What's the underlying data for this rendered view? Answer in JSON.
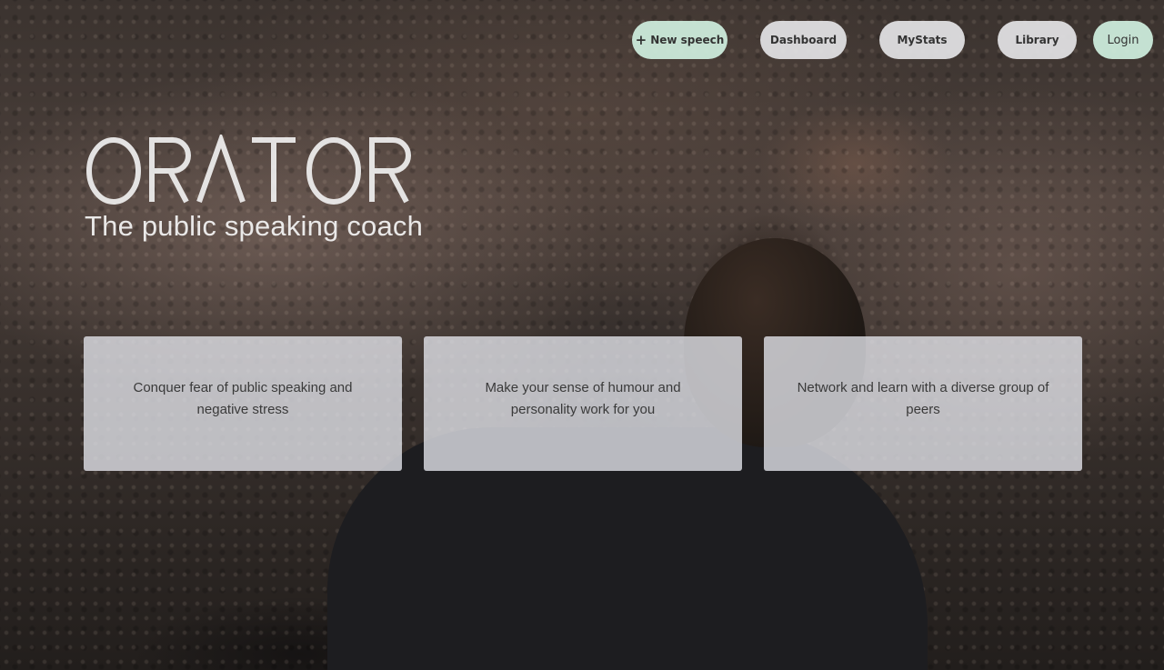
{
  "nav": {
    "new_speech": "New speech",
    "dashboard": "Dashboard",
    "mystats": "MyStats",
    "library": "Library",
    "login": "Login",
    "new_speech_icon": "plus-icon"
  },
  "hero": {
    "logo_text": "ORATOR",
    "tagline": "The public speaking coach"
  },
  "cards": [
    {
      "text": "Conquer fear of public speaking and negative stress"
    },
    {
      "text": "Make your sense of humour and personality work for you"
    },
    {
      "text": "Network and learn with a diverse group of peers"
    }
  ],
  "colors": {
    "nav_grey": "#e4e4e6",
    "nav_mint": "#cdecdc",
    "card_bg": "#e1e2e8",
    "text_light": "#f5f5f5"
  }
}
